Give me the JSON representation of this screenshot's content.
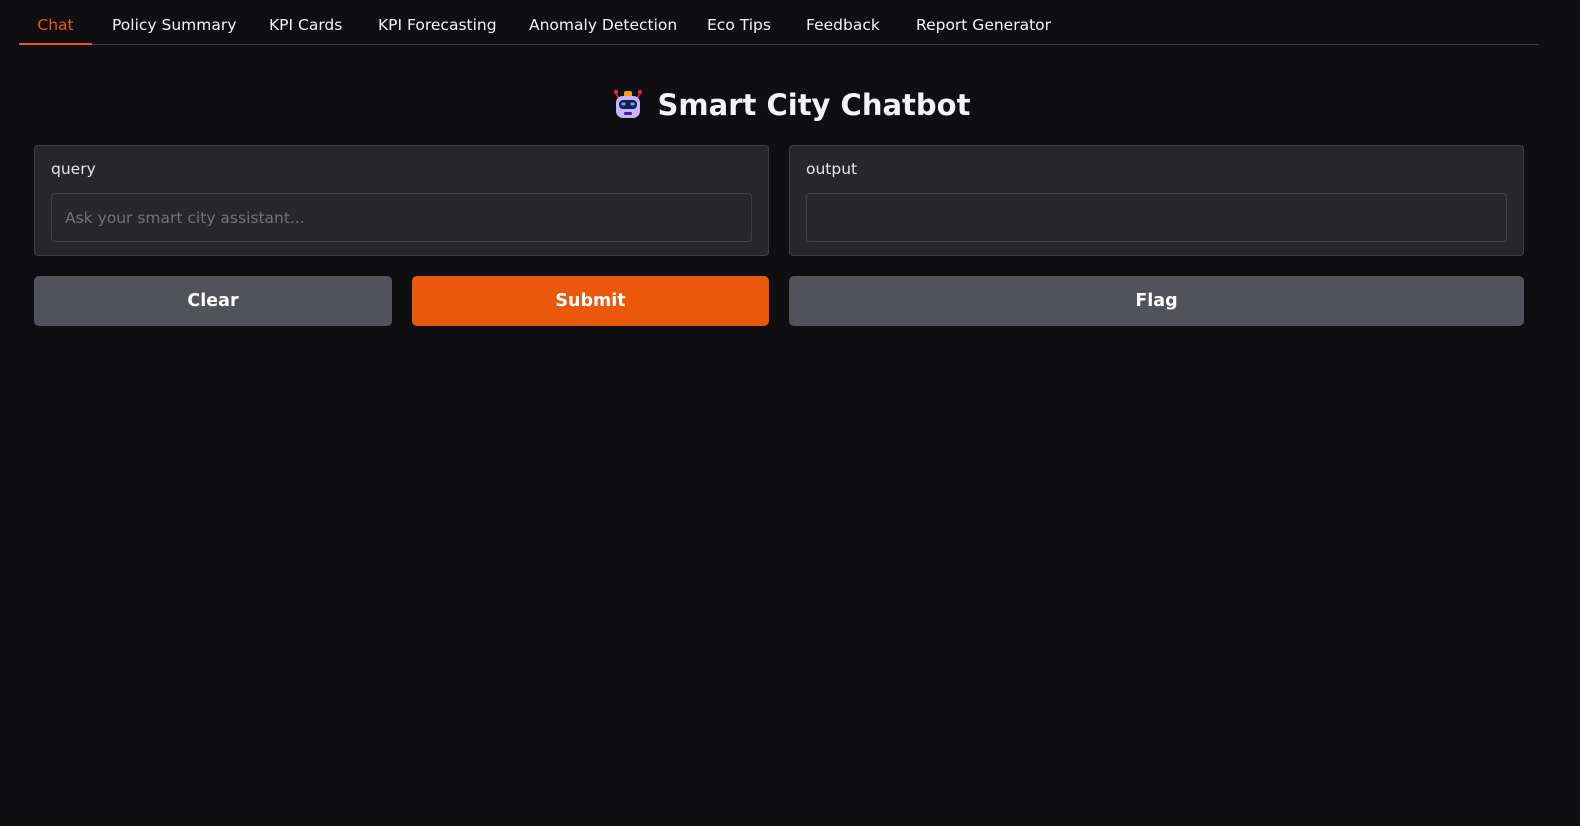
{
  "tabs": [
    {
      "label": "Chat",
      "active": true
    },
    {
      "label": "Policy Summary",
      "active": false
    },
    {
      "label": "KPI Cards",
      "active": false
    },
    {
      "label": "KPI Forecasting",
      "active": false
    },
    {
      "label": "Anomaly Detection",
      "active": false
    },
    {
      "label": "Eco Tips",
      "active": false
    },
    {
      "label": "Feedback",
      "active": false
    },
    {
      "label": "Report Generator",
      "active": false
    }
  ],
  "header": {
    "icon": "robot-icon",
    "title": "Smart City Chatbot"
  },
  "query": {
    "label": "query",
    "value": "",
    "placeholder": "Ask your smart city assistant..."
  },
  "output": {
    "label": "output",
    "value": ""
  },
  "buttons": {
    "clear": "Clear",
    "submit": "Submit",
    "flag": "Flag"
  },
  "colors": {
    "accent": "#ea580c",
    "background": "#0f0f11",
    "panel": "#27272a",
    "secondary_button": "#52525b"
  }
}
